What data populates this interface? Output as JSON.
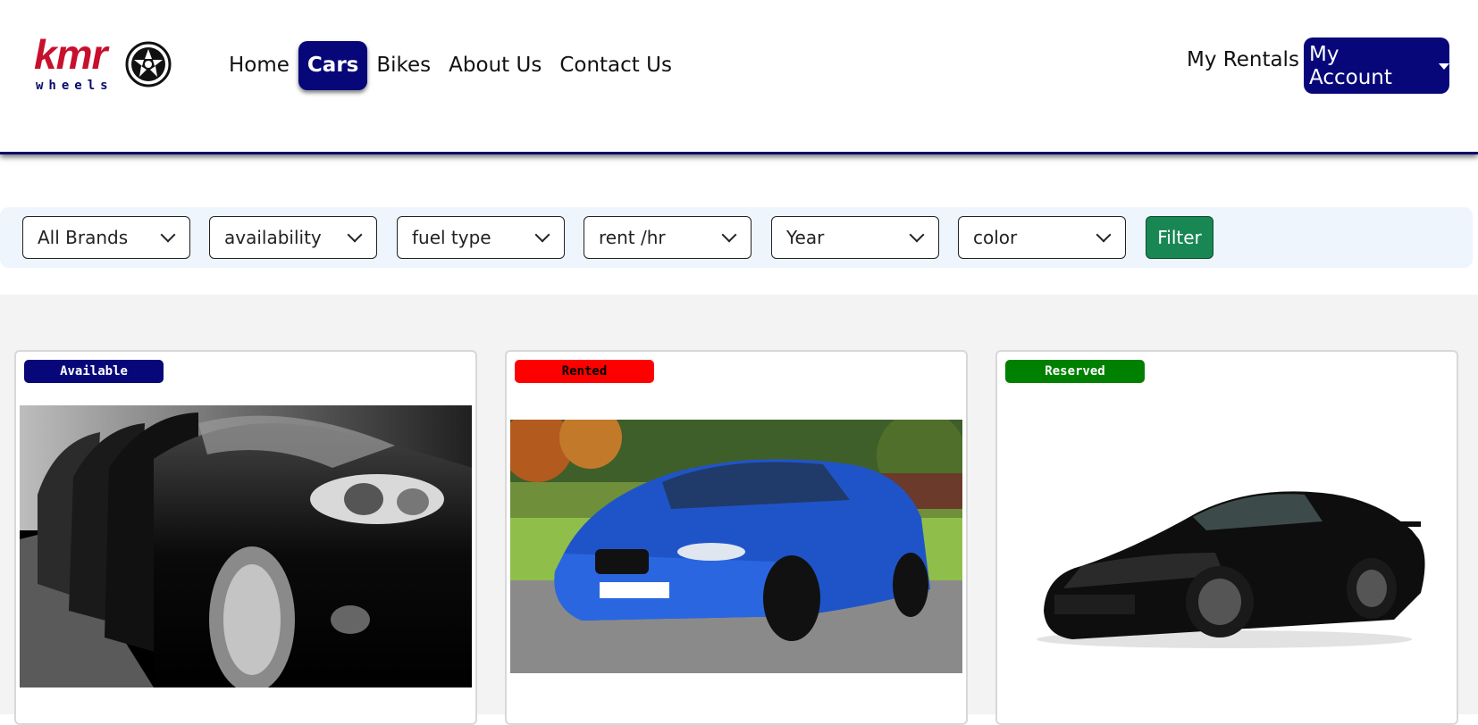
{
  "brand": {
    "logo_text": "kmr",
    "logo_sub": "wheels"
  },
  "nav": {
    "items": [
      {
        "label": "Home",
        "active": false
      },
      {
        "label": "Cars",
        "active": true
      },
      {
        "label": "Bikes",
        "active": false
      },
      {
        "label": "About Us",
        "active": false
      },
      {
        "label": "Contact Us",
        "active": false
      }
    ],
    "my_rentals": "My Rentals",
    "account_label": "My Account"
  },
  "filters": {
    "selects": [
      {
        "value": "All Brands"
      },
      {
        "value": "availability"
      },
      {
        "value": "fuel type"
      },
      {
        "value": "rent /hr"
      },
      {
        "value": "Year"
      },
      {
        "value": "color"
      }
    ],
    "button_label": "Filter"
  },
  "cars": [
    {
      "status": "Available",
      "badge_bg": "#07077a",
      "badge_fg": "#ffffff",
      "image": "black-car-closeup"
    },
    {
      "status": "Rented",
      "badge_bg": "#ff0000",
      "badge_fg": "#000000",
      "image": "blue-sedan"
    },
    {
      "status": "Reserved",
      "badge_bg": "#008000",
      "badge_fg": "#ffffff",
      "image": "black-sports-car"
    }
  ],
  "colors": {
    "primary": "#07077a",
    "success": "#198754",
    "logo_red": "#c8102e"
  }
}
